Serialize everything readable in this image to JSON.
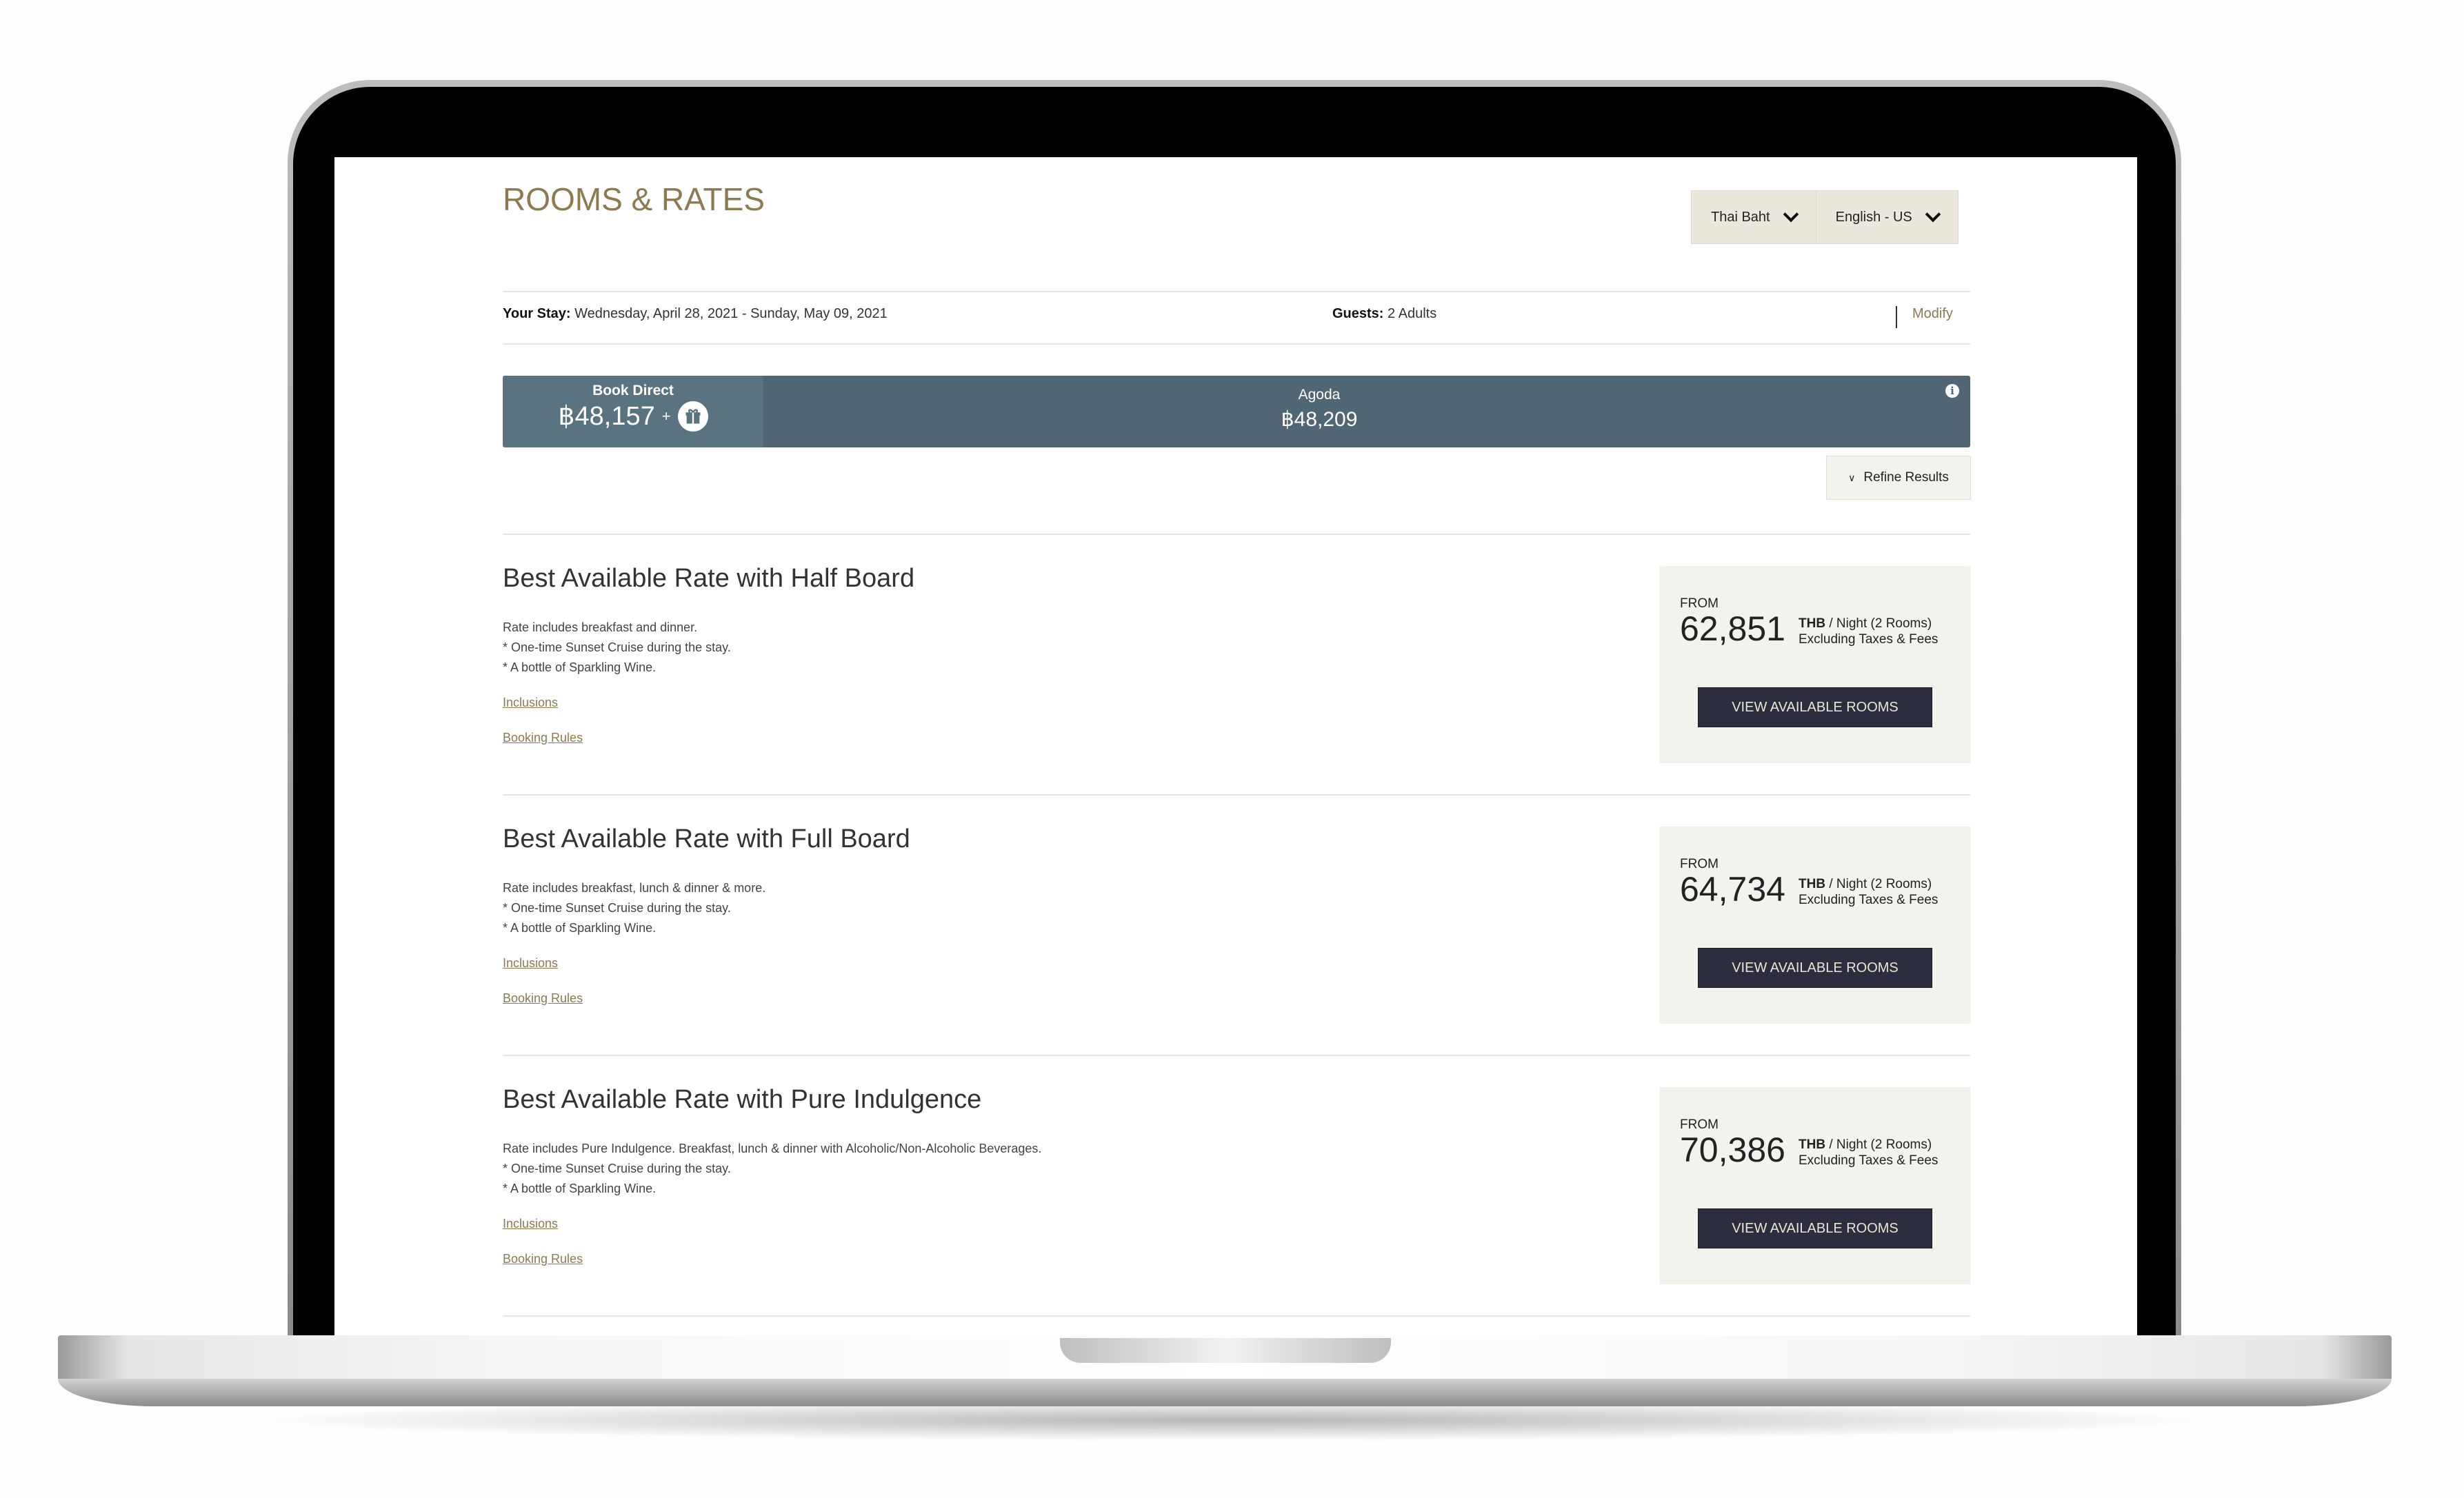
{
  "page": {
    "title": "ROOMS & RATES",
    "currency_select": "Thai Baht",
    "language_select": "English - US"
  },
  "stay": {
    "label": "Your Stay:",
    "dates": "Wednesday, April 28, 2021 - Sunday, May 09, 2021",
    "guests_label": "Guests:",
    "guests_value": "2 Adults",
    "modify": "Modify"
  },
  "compare": {
    "direct_label": "Book Direct",
    "direct_price": "฿48,157",
    "plus": "+",
    "other_label": "Agoda",
    "other_price": "฿48,209",
    "info": "i"
  },
  "refine": {
    "label": "Refine Results"
  },
  "rates": [
    {
      "title": "Best Available Rate with Half Board",
      "lines": [
        "Rate includes breakfast and dinner.",
        "* One-time Sunset Cruise during the stay.",
        "* A bottle of Sparkling Wine."
      ],
      "inclusions": "Inclusions",
      "booking_rules": "Booking Rules",
      "from": "FROM",
      "price": "62,851",
      "currency": "THB",
      "per": " / Night (2 Rooms)",
      "note": "Excluding Taxes & Fees",
      "button": "VIEW AVAILABLE ROOMS"
    },
    {
      "title": "Best Available Rate with Full Board",
      "lines": [
        "Rate includes breakfast, lunch & dinner & more.",
        "* One-time Sunset Cruise during the stay.",
        "* A bottle of Sparkling Wine."
      ],
      "inclusions": "Inclusions",
      "booking_rules": "Booking Rules",
      "from": "FROM",
      "price": "64,734",
      "currency": "THB",
      "per": " / Night (2 Rooms)",
      "note": "Excluding Taxes & Fees",
      "button": "VIEW AVAILABLE ROOMS"
    },
    {
      "title": "Best Available Rate with Pure Indulgence",
      "lines": [
        "Rate includes Pure Indulgence. Breakfast, lunch & dinner with Alcoholic/Non-Alcoholic Beverages.",
        "* One-time Sunset Cruise during the stay.",
        "* A bottle of Sparkling Wine."
      ],
      "inclusions": "Inclusions",
      "booking_rules": "Booking Rules",
      "from": "FROM",
      "price": "70,386",
      "currency": "THB",
      "per": " / Night (2 Rooms)",
      "note": "Excluding Taxes & Fees",
      "button": "VIEW AVAILABLE ROOMS"
    }
  ]
}
